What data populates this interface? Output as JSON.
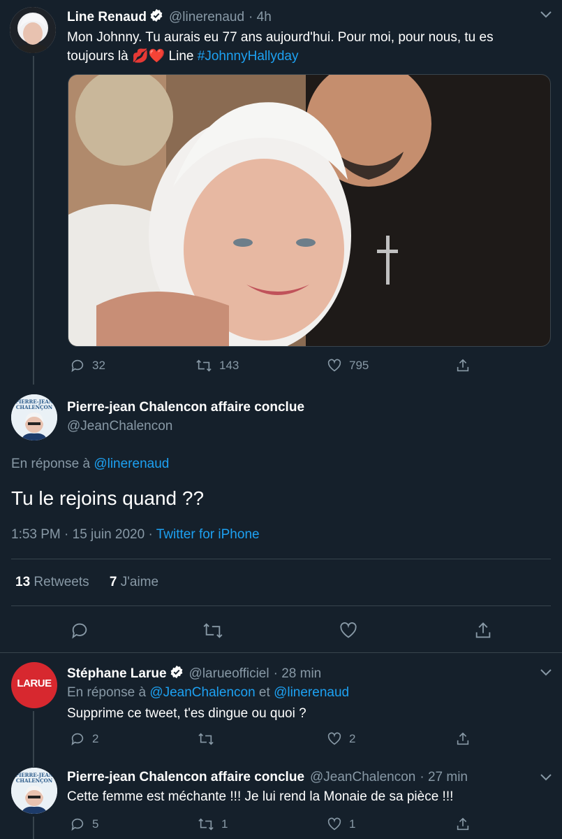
{
  "colors": {
    "background": "#15202b",
    "link": "#1da1f2",
    "muted": "#8899a6",
    "divider": "#38444d",
    "verified": "#ffffff"
  },
  "tweet1": {
    "name": "Line Renaud",
    "handle": "@linerenaud",
    "time": "· 4h",
    "text_a": "Mon Johnny. Tu aurais eu 77 ans aujourd'hui. Pour moi, pour nous, tu es",
    "text_b": "toujours là",
    "emoji": "💋❤️",
    "text_c": " Line ",
    "hashtag": "#JohnnyHallyday",
    "replies": "32",
    "retweets": "143",
    "likes": "795"
  },
  "focus": {
    "name": "Pierre-jean Chalencon affaire conclue",
    "handle": "@JeanChalencon",
    "reply_prefix": "En réponse à ",
    "reply_to": "@linerenaud",
    "text": "Tu le rejoins quand ??",
    "time": "1:53 PM · 15 juin 2020 · ",
    "source": "Twitter for iPhone",
    "retweets_count": "13",
    "retweets_label": "Retweets",
    "likes_count": "7",
    "likes_label": "J'aime"
  },
  "reply1": {
    "name": "Stéphane Larue",
    "handle": "@larueofficiel",
    "time": "· 28 min",
    "reply_prefix": "En réponse à ",
    "reply_to_1": "@JeanChalencon",
    "and": " et ",
    "reply_to_2": "@linerenaud",
    "text": "Supprime ce tweet, t'es dingue ou quoi ?",
    "avatar_text": "LARUE",
    "replies": "2",
    "retweets": "",
    "likes": "2"
  },
  "reply2": {
    "name": "Pierre-jean Chalencon affaire conclue",
    "handle": "@JeanChalencon",
    "time": "· 27 min",
    "text": "Cette femme est méchante !!! Je lui rend la Monaie de sa pièce !!!",
    "replies": "5",
    "retweets": "1",
    "likes": "1"
  },
  "avatar_pj_text": "PIERRE-JEAN CHALENÇON"
}
